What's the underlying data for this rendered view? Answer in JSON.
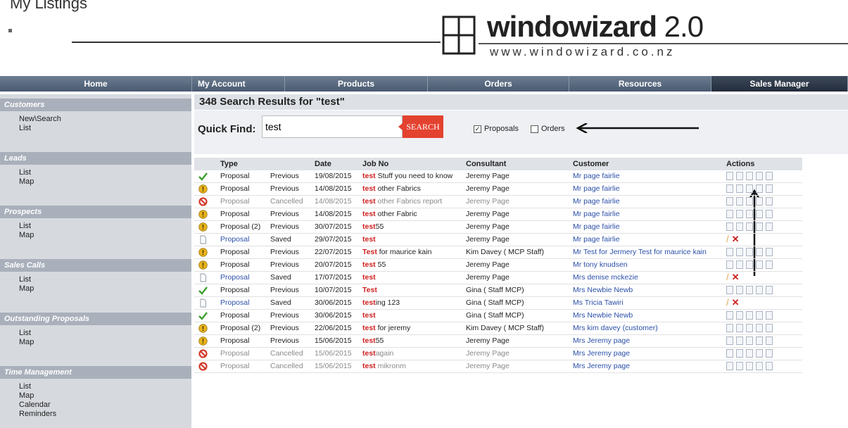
{
  "header": {
    "cut_text": "My Listings",
    "logo_name": "windowizard",
    "logo_version": "2.0",
    "logo_url": "www.windowizard.co.nz"
  },
  "nav": [
    "Home",
    "My Account",
    "Products",
    "Orders",
    "Resources",
    "Sales Manager"
  ],
  "sidebar": [
    {
      "title": "Customers",
      "items": [
        "New\\Search",
        "List"
      ]
    },
    {
      "title": "Leads",
      "items": [
        "List",
        "Map"
      ]
    },
    {
      "title": "Prospects",
      "items": [
        "List",
        "Map"
      ]
    },
    {
      "title": "Sales Calls",
      "items": [
        "List",
        "Map"
      ]
    },
    {
      "title": "Outstanding Proposals",
      "items": [
        "List",
        "Map"
      ]
    },
    {
      "title": "Time Management",
      "items": [
        "List",
        "Map",
        "Calendar",
        "Reminders"
      ]
    }
  ],
  "results": {
    "title": "348 Search Results for \"test\""
  },
  "quick_find": {
    "label": "Quick Find:",
    "value": "test",
    "button": "SEARCH",
    "proposals_label": "Proposals",
    "proposals_checked": true,
    "orders_label": "Orders",
    "orders_checked": false
  },
  "table": {
    "headers": [
      "Type",
      "Date",
      "Job No",
      "Consultant",
      "Customer",
      "Actions"
    ],
    "rows": [
      {
        "icon": "check",
        "type": "Proposal",
        "status": "Previous",
        "date": "19/08/2015",
        "job_key": "test",
        "job_rest": " Stuff you need to know",
        "consultant": "Jeremy Page",
        "customer": "Mr page fairlie",
        "actions": "docs"
      },
      {
        "icon": "info",
        "type": "Proposal",
        "status": "Previous",
        "date": "14/08/2015",
        "job_key": "test",
        "job_rest": " other Fabrics",
        "consultant": "Jeremy Page",
        "customer": "Mr page fairlie",
        "actions": "docs"
      },
      {
        "icon": "cancel",
        "type": "Proposal",
        "status": "Cancelled",
        "date": "14/08/2015",
        "job_key": "test",
        "job_rest": " other Fabrics report",
        "consultant": "Jeremy Page",
        "customer": "Mr page fairlie",
        "actions": "docs"
      },
      {
        "icon": "info",
        "type": "Proposal",
        "status": "Previous",
        "date": "14/08/2015",
        "job_key": "test",
        "job_rest": " other Fabric",
        "consultant": "Jeremy Page",
        "customer": "Mr page fairlie",
        "actions": "docs"
      },
      {
        "icon": "info",
        "type": "Proposal (2)",
        "status": "Previous",
        "date": "30/07/2015",
        "job_key": "test",
        "job_rest": "55",
        "consultant": "Jeremy Page",
        "customer": "Mr page fairlie",
        "actions": "docs"
      },
      {
        "icon": "doc",
        "type": "Proposal",
        "status": "Saved",
        "date": "29/07/2015",
        "job_key": "test",
        "job_rest": "",
        "consultant": "Jeremy Page",
        "customer": "Mr page fairlie",
        "actions": "edit"
      },
      {
        "icon": "info",
        "type": "Proposal",
        "status": "Previous",
        "date": "22/07/2015",
        "job_key": "Test",
        "job_rest": " for maurice kain",
        "consultant": "Kim Davey ( MCP Staff)",
        "customer": "Mr Test for Jermery Test for maurice kain",
        "actions": "docs"
      },
      {
        "icon": "info",
        "type": "Proposal",
        "status": "Previous",
        "date": "20/07/2015",
        "job_key": "test",
        "job_rest": " 55",
        "consultant": "Jeremy Page",
        "customer": "Mr tony knudsen",
        "actions": "docs"
      },
      {
        "icon": "doc",
        "type": "Proposal",
        "status": "Saved",
        "date": "17/07/2015",
        "job_key": "test",
        "job_rest": "",
        "consultant": "Jeremy Page",
        "customer": "Mrs denise mckezie",
        "actions": "edit"
      },
      {
        "icon": "check",
        "type": "Proposal",
        "status": "Previous",
        "date": "10/07/2015",
        "job_key": "Test",
        "job_rest": "",
        "consultant": "Gina ( Staff MCP)",
        "customer": "Mrs Newbie Newb",
        "actions": "docs"
      },
      {
        "icon": "doc",
        "type": "Proposal",
        "status": "Saved",
        "date": "30/06/2015",
        "job_key": "test",
        "job_rest": "ing 123",
        "consultant": "Gina ( Staff MCP)",
        "customer": "Ms Tricia Tawiri",
        "actions": "edit"
      },
      {
        "icon": "check",
        "type": "Proposal",
        "status": "Previous",
        "date": "30/06/2015",
        "job_key": "test",
        "job_rest": "",
        "consultant": "Gina ( Staff MCP)",
        "customer": "Mrs Newbie Newb",
        "actions": "docs"
      },
      {
        "icon": "info",
        "type": "Proposal (2)",
        "status": "Previous",
        "date": "22/06/2015",
        "job_key": "test",
        "job_rest": " for jeremy",
        "consultant": "Kim Davey ( MCP Staff)",
        "customer": "Mrs kim davey (customer)",
        "actions": "docs"
      },
      {
        "icon": "info",
        "type": "Proposal",
        "status": "Previous",
        "date": "15/06/2015",
        "job_key": "test",
        "job_rest": "55",
        "consultant": "Jeremy Page",
        "customer": "Mrs Jeremy page",
        "actions": "docs"
      },
      {
        "icon": "cancel",
        "type": "Proposal",
        "status": "Cancelled",
        "date": "15/06/2015",
        "job_key": "test",
        "job_rest": "again",
        "consultant": "Jeremy Page",
        "customer": "Mrs Jeremy page",
        "actions": "docs"
      },
      {
        "icon": "cancel",
        "type": "Proposal",
        "status": "Cancelled",
        "date": "15/06/2015",
        "job_key": "test",
        "job_rest": " mikronm",
        "consultant": "Jeremy Page",
        "customer": "Mrs Jeremy page",
        "actions": "docs"
      }
    ]
  },
  "colors": {
    "nav": "#55657b",
    "accent": "#e44230",
    "link": "#2a4fa8",
    "keyword": "#d02020"
  }
}
